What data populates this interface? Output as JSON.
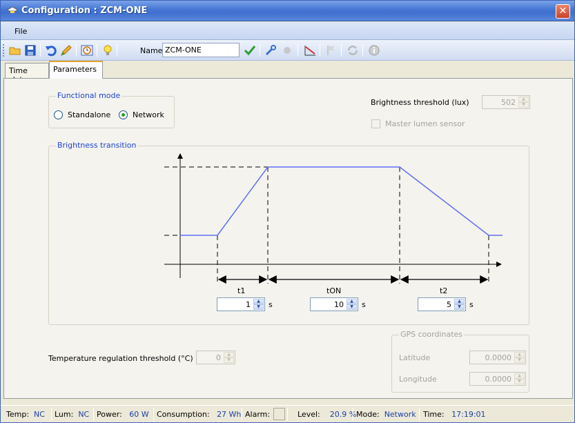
{
  "window": {
    "title": "Configuration : ZCM-ONE",
    "close": "✕"
  },
  "menu": {
    "file": "File"
  },
  "toolbar": {
    "name_label": "Name",
    "name_value": "ZCM-ONE",
    "icons": [
      "open-folder-icon",
      "save-icon",
      "undo-icon",
      "edit-pencil-icon",
      "clock-icon",
      "bulb-icon",
      "checkmark-icon",
      "wrench-icon",
      "circle-icon",
      "curve-icon",
      "flag-icon",
      "refresh-icon",
      "info-icon"
    ]
  },
  "tabs": [
    {
      "label": "Time slots",
      "active": false
    },
    {
      "label": "Parameters",
      "active": true
    }
  ],
  "functional_mode": {
    "title": "Functional mode",
    "options": [
      "Standalone",
      "Network"
    ],
    "selected": "Network"
  },
  "brightness_threshold": {
    "label": "Brightness threshold (lux)",
    "value": "502"
  },
  "master_lumen": {
    "label": "Master lumen sensor",
    "checked": false
  },
  "brightness_transition": {
    "title": "Brightness transition",
    "t1": {
      "label": "t1",
      "value": "1",
      "unit": "s"
    },
    "ton": {
      "label": "tON",
      "value": "10",
      "unit": "s"
    },
    "t2": {
      "label": "t2",
      "value": "5",
      "unit": "s"
    }
  },
  "temperature": {
    "label": "Temperature regulation threshold (°C)",
    "value": "0"
  },
  "gps": {
    "title": "GPS coordinates",
    "latitude_label": "Latitude",
    "latitude": "0.0000",
    "longitude_label": "Longitude",
    "longitude": "0.0000"
  },
  "status": {
    "temp_label": "Temp:",
    "temp": "NC",
    "lum_label": "Lum:",
    "lum": "NC",
    "power_label": "Power:",
    "power": "60 W",
    "consumption_label": "Consumption:",
    "consumption": "27 Wh",
    "alarm_label": "Alarm:",
    "level_label": "Level:",
    "level": "20.9 %",
    "mode_label": "Mode:",
    "mode": "Network",
    "time_label": "Time:",
    "time": "17:19:01"
  },
  "colors": {
    "accent_blue": "#1e44d0",
    "curve": "#5e6ef5",
    "status_value": "#1a3ea8"
  }
}
